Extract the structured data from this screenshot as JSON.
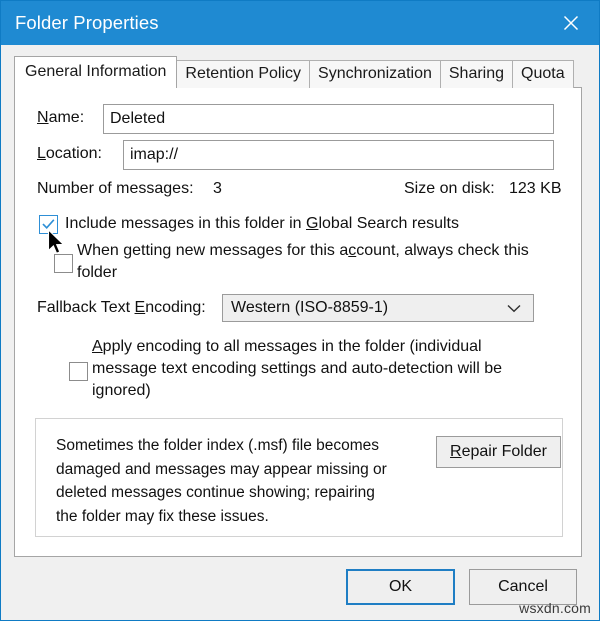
{
  "window": {
    "title": "Folder Properties",
    "close_icon": "close-icon",
    "titlebar_color": "#1f8ad2",
    "accent_color": "#1f7ec4"
  },
  "tabs": [
    {
      "label": "General Information",
      "active": true
    },
    {
      "label": "Retention Policy",
      "active": false
    },
    {
      "label": "Synchronization",
      "active": false
    },
    {
      "label": "Sharing",
      "active": false
    },
    {
      "label": "Quota",
      "active": false
    }
  ],
  "general": {
    "name_label_pre": "",
    "name_label_accel": "N",
    "name_label_post": "ame:",
    "name_value": "Deleted",
    "location_label_accel": "L",
    "location_label_post": "ocation:",
    "location_value": "imap://",
    "messages_label": "Number of messages:",
    "messages_value": "3",
    "size_label": "Size on disk:",
    "size_value": "123 KB",
    "global_search": {
      "checked": true,
      "text_pre": "Include messages in this folder in ",
      "text_accel": "G",
      "text_post": "lobal Search results"
    },
    "check_on_new_mail": {
      "checked": false,
      "line1_pre": "When getting new messages for this a",
      "line1_accel": "c",
      "line1_post": "count, always check this",
      "line2": "folder"
    },
    "encoding_label_pre": "Fallback Text ",
    "encoding_label_accel": "E",
    "encoding_label_post": "ncoding:",
    "encoding_value": "Western (ISO-8859-1)",
    "encoding_dropdown_icon": "chevron-down-icon",
    "apply_encoding": {
      "checked": false,
      "line1_accel": "A",
      "line1_post": "pply encoding to all messages in the folder (individual",
      "line2": "message text encoding settings and auto-detection will be",
      "line3": "ignored)"
    },
    "repair": {
      "line1": "Sometimes the folder index (.msf) file becomes",
      "line2": "damaged and messages may appear missing or",
      "line3": "deleted messages continue showing; repairing",
      "line4": "the folder may fix these issues.",
      "button_accel": "R",
      "button_post": "epair Folder"
    }
  },
  "footer": {
    "ok_label": "OK",
    "cancel_label": "Cancel"
  },
  "watermark": "wsxdn.com"
}
